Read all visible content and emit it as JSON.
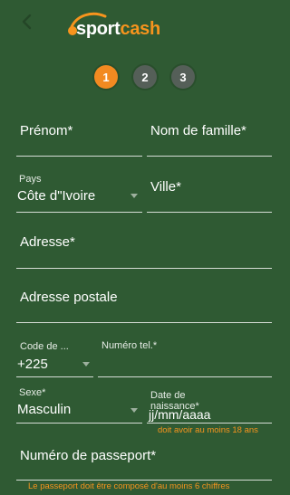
{
  "header": {
    "logo": {
      "part1": "sport",
      "part2": "cash"
    }
  },
  "steps": [
    "1",
    "2",
    "3"
  ],
  "form": {
    "first_name": {
      "label": "Prénom*"
    },
    "last_name": {
      "label": "Nom de famille*"
    },
    "country": {
      "label": "Pays",
      "value": "Côte d\"Ivoire"
    },
    "city": {
      "label": "Ville*"
    },
    "address": {
      "label": "Adresse*"
    },
    "postal_address": {
      "label": "Adresse postale"
    },
    "country_code": {
      "label": "Code de ...",
      "value": "+225"
    },
    "phone": {
      "label": "Numéro tel.*"
    },
    "gender": {
      "label": "Sexe*",
      "value": "Masculin"
    },
    "birth_date": {
      "label": "Date de naissance*",
      "value": "jj/mm/aaaa",
      "hint": "doit avoir au moins 18 ans"
    },
    "passport": {
      "label": "Numéro de passeport*",
      "hint": "Le passeport doit être composé d'au moins 6 chiffres"
    }
  },
  "colors": {
    "background": "#2f5a33",
    "accent": "#f28a21",
    "inactive_step": "#555f58"
  }
}
